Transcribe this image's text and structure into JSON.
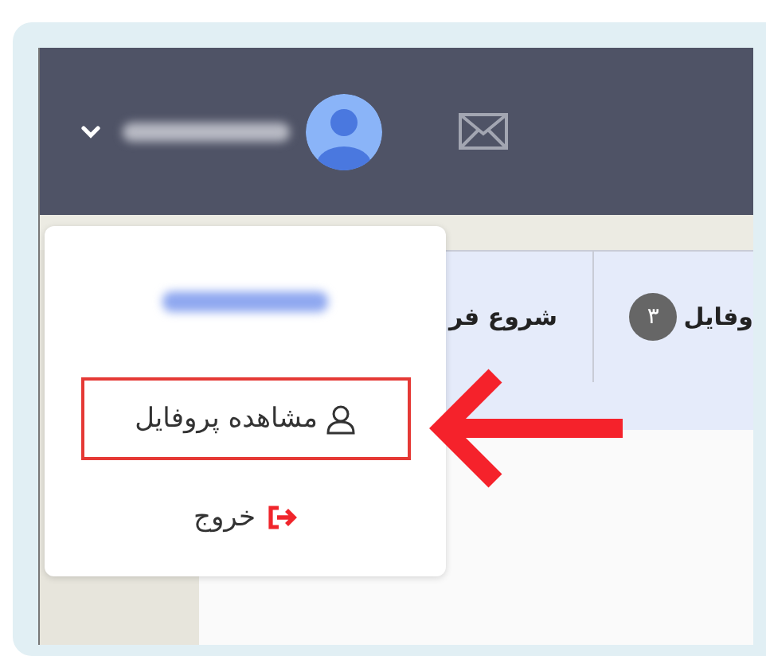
{
  "menu": {
    "items": [
      {
        "kind": "profile",
        "label": "مشاهده پروفایل",
        "highlighted": true
      },
      {
        "kind": "logout",
        "label": "خروج",
        "highlighted": false
      }
    ]
  },
  "tabs": [
    {
      "label": "وفایل",
      "badge": "۳"
    },
    {
      "label": "شروع فر"
    }
  ]
}
